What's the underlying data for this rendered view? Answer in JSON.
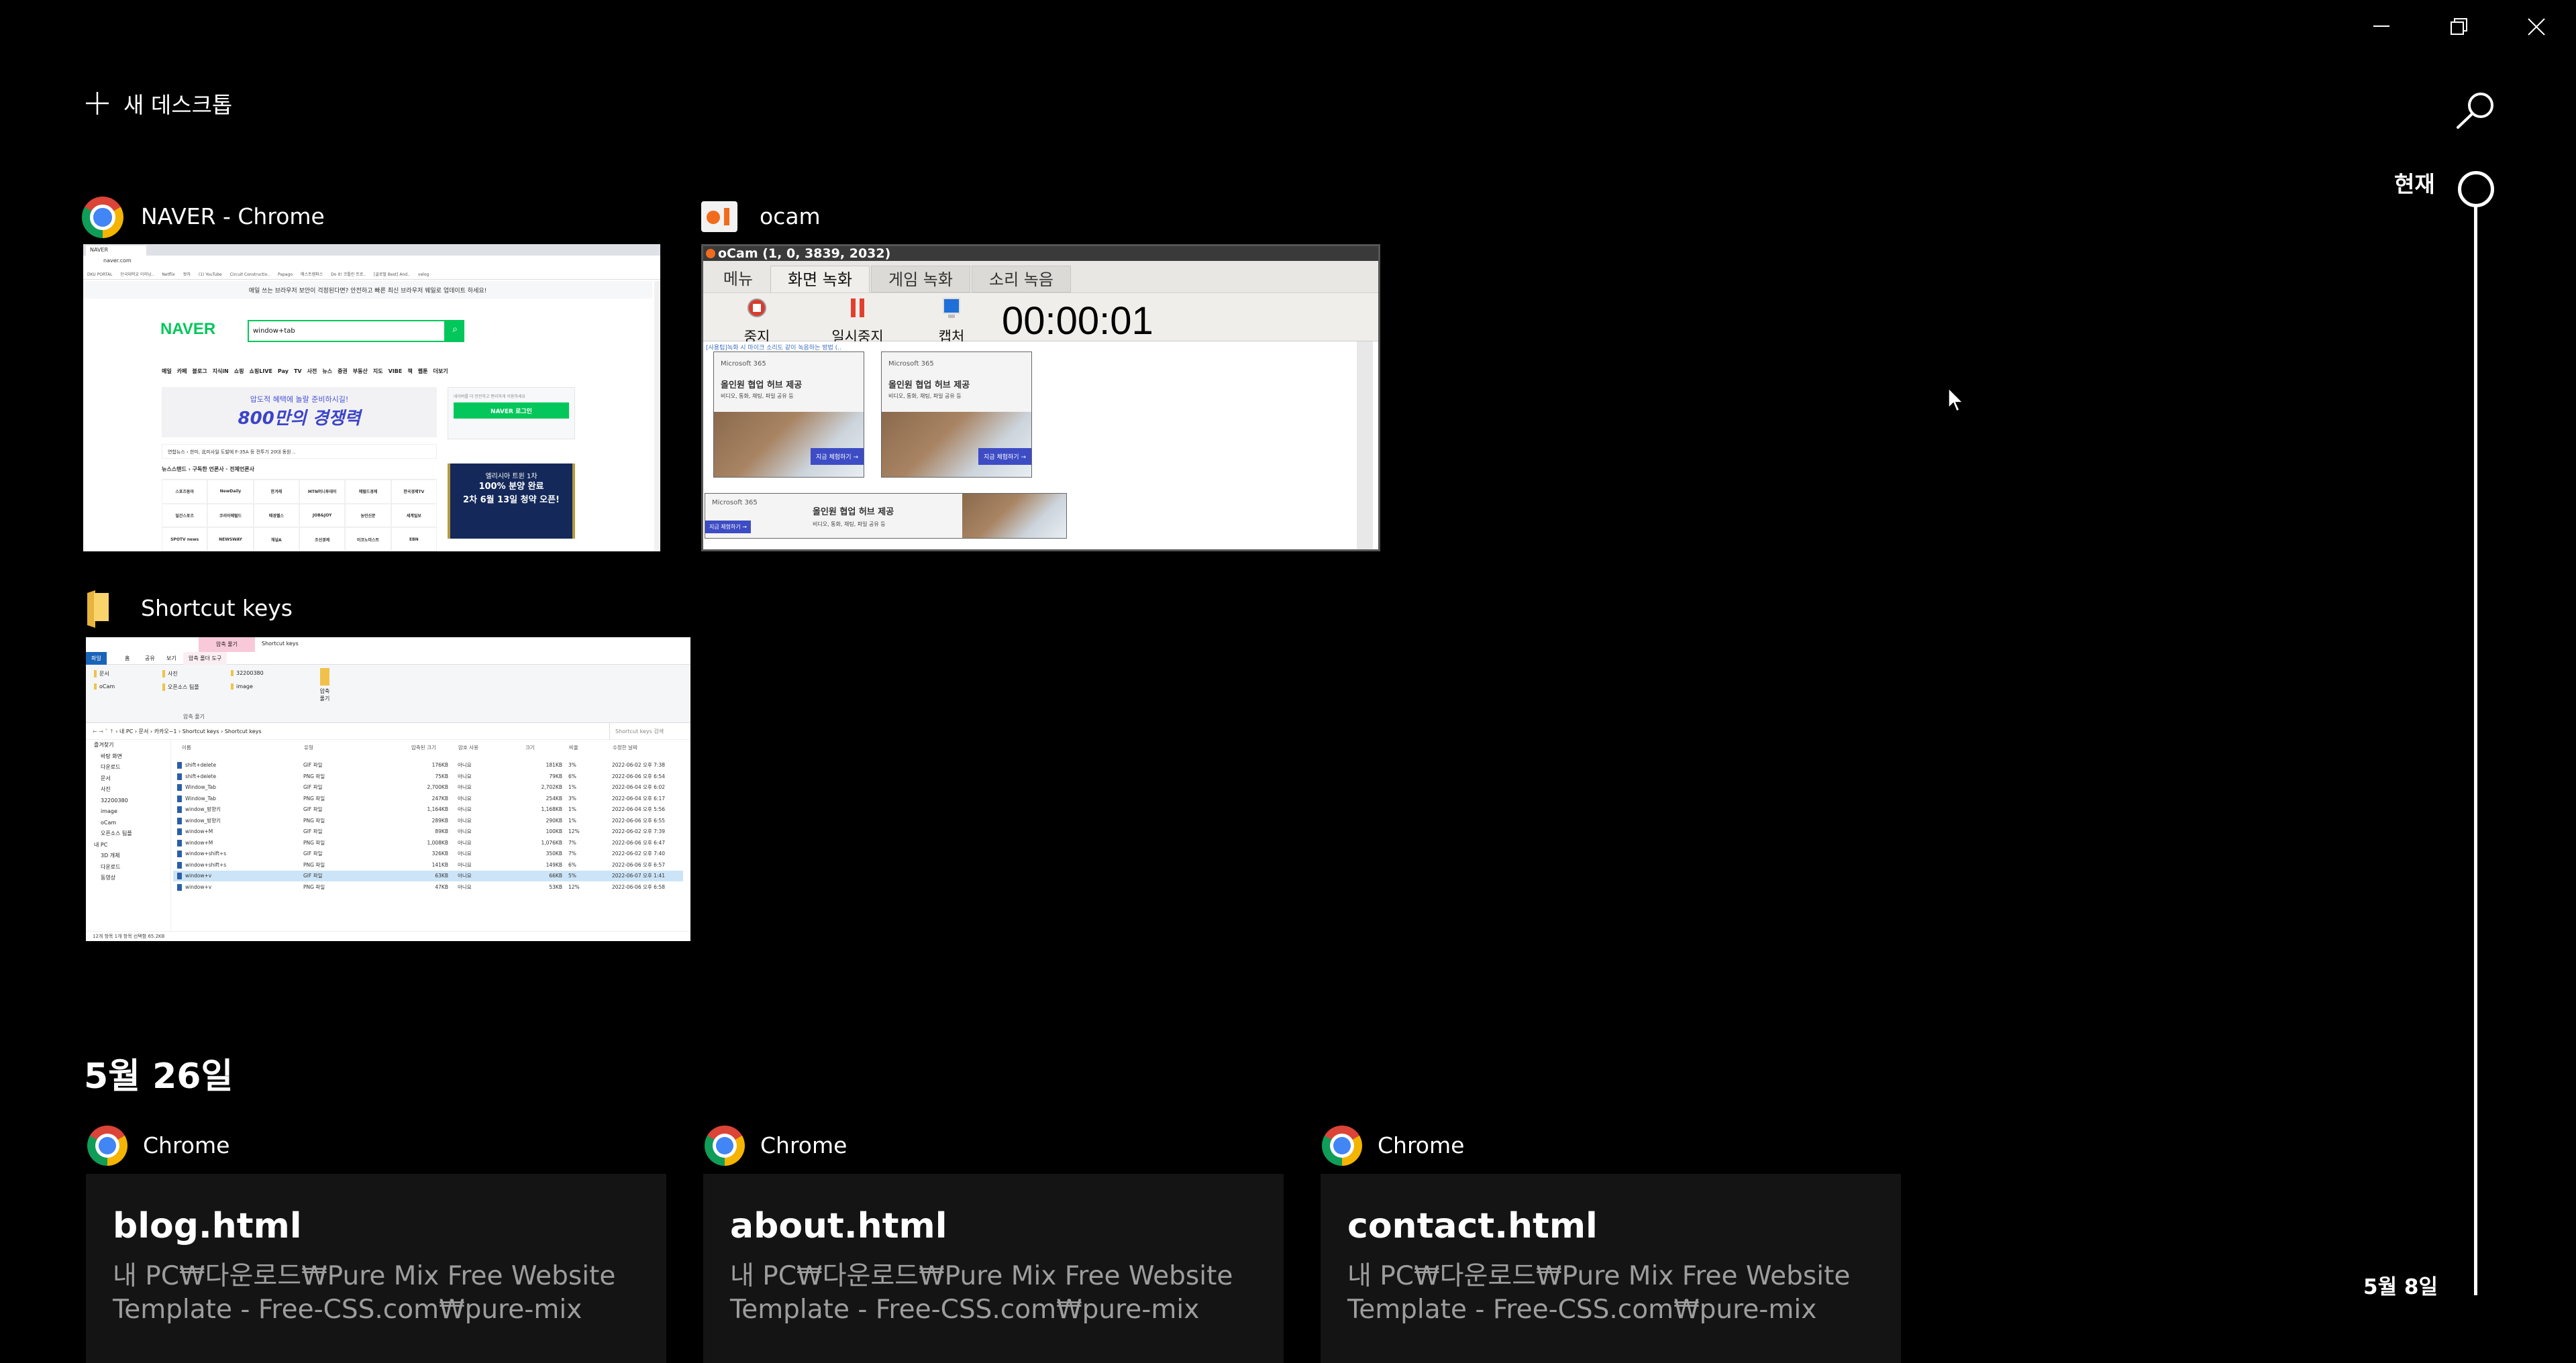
{
  "window_controls": {
    "minimize": "minimize",
    "restore": "restore",
    "close": "close"
  },
  "new_desktop": {
    "icon": "plus-icon",
    "label": "새 데스크톱"
  },
  "search": {
    "icon": "search-icon"
  },
  "timeline": {
    "current_label": "현재",
    "end_label": "5월 8일"
  },
  "open_windows": [
    {
      "title": "NAVER - Chrome",
      "icon": "chrome-icon"
    },
    {
      "title": "ocam",
      "icon": "ocam-icon"
    },
    {
      "title": "Shortcut keys",
      "icon": "folder-icon"
    }
  ],
  "naver": {
    "tab": "NAVER",
    "url": "naver.com",
    "bookmarks": [
      "DKU PORTAL",
      "단국대학교 이러닝..",
      "Netflix",
      "왓챠",
      "(1) YouTube",
      "Circuit Constructio..",
      "Papago",
      "메스트캠퍼스",
      "Do it! 코틀린 프로..",
      "[골로벌 Best] And..",
      "velog"
    ],
    "notice": "매일 쓰는 브라우저 보안이 걱정된다면? 안전하고 빠른 최신 브라우저 웨일로 업데이트 하세요!",
    "logo": "NAVER",
    "search_value": "window+tab",
    "menu": [
      "메일",
      "카페",
      "블로그",
      "지식iN",
      "쇼핑",
      "쇼핑LIVE",
      "Pay",
      "TV",
      "사전",
      "뉴스",
      "증권",
      "부동산",
      "지도",
      "VIBE",
      "책",
      "웹툰",
      "더보기"
    ],
    "banner_line1": "압도적 혜택에 놀랄 준비하시길!",
    "banner_line2": "800만의 경쟁력",
    "login_hint": "네이버를 더 안전하고 편리하게 이용하세요",
    "login_button": "NAVER 로그인",
    "news": "연합뉴스 › 한미, 北미사일 도발에 F-35A 등 전투기 20대 동원 ..",
    "newsstand": "뉴스스탠드 › 구독한 언론사 · 전체언론사",
    "press": [
      "스포츠동아",
      "NewDaily",
      "한겨레",
      "MTN머니투데이",
      "헤럴드경제",
      "한국경제TV",
      "일간스포츠",
      "코리아헤럴드",
      "매경헬스",
      "JOB&JOY",
      "농민신문",
      "세계일보",
      "SPOTV news",
      "NEWSWAY",
      "채널A",
      "조선경제",
      "이코노미스트",
      "EBN"
    ],
    "ad_line1": "엘리시아 트윈 1차",
    "ad_line2": "100% 분양 완료",
    "ad_line3": "2차 6월 13일 청약 오픈!"
  },
  "ocam": {
    "title": "oCam (1, 0, 3839, 2032)",
    "tabs": [
      "메뉴",
      "화면 녹화",
      "게임 녹화",
      "소리 녹음"
    ],
    "active_tab": "화면 녹화",
    "buttons": [
      {
        "label": "중지",
        "icon": "stop-icon"
      },
      {
        "label": "일시중지",
        "icon": "pause-icon"
      },
      {
        "label": "캡처",
        "icon": "monitor-icon"
      }
    ],
    "timer": "00:00:01",
    "tip_link": "[사용팁]녹화 시 마이크 소리도 같이 녹음하는 방법 (..",
    "ad_brand": "Microsoft 365",
    "ad_headline": "올인원 협업 허브 제공",
    "ad_sub": "비디오, 통화, 채팅, 파일 공유 등",
    "ad_cta": "지금 체험하기 →"
  },
  "explorer": {
    "context_tab": "압축 풀기",
    "window_title": "Shortcut keys",
    "tabs": [
      "파일",
      "홈",
      "공유",
      "보기",
      "압축 폴더 도구"
    ],
    "ribbon_items": [
      "문서",
      "사진",
      "32200380",
      "oCam",
      "오픈소스 팀플",
      "image"
    ],
    "ribbon_group": "압축 풀기",
    "extract_all": "압축 풀기",
    "breadcrumb": "› 내 PC › 문서 › 카카오~1 › Shortcut keys › Shortcut keys",
    "search_placeholder": "Shortcut keys 검색",
    "nav": [
      "즐겨찾기",
      "바탕 화면",
      "다운로드",
      "문서",
      "사진",
      "32200380",
      "image",
      "oCam",
      "오픈소스 팀플",
      "내 PC",
      "3D 개체",
      "다운로드",
      "동영상"
    ],
    "columns": [
      "이름",
      "유형",
      "압축된 크기",
      "암호 사용",
      "크기",
      "비율",
      "수정한 날짜"
    ],
    "files": [
      [
        "shift+delete",
        "GIF 파일",
        "176KB",
        "아니요",
        "181KB",
        "3%",
        "2022-06-02 오후 7:38"
      ],
      [
        "shift+delete",
        "PNG 파일",
        "75KB",
        "아니요",
        "79KB",
        "6%",
        "2022-06-06 오후 6:54"
      ],
      [
        "Window_Tab",
        "GIF 파일",
        "2,700KB",
        "아니요",
        "2,702KB",
        "1%",
        "2022-06-04 오후 6:02"
      ],
      [
        "Window_Tab",
        "PNG 파일",
        "247KB",
        "아니요",
        "254KB",
        "3%",
        "2022-06-04 오후 6:17"
      ],
      [
        "window_방향키",
        "GIF 파일",
        "1,164KB",
        "아니요",
        "1,168KB",
        "1%",
        "2022-06-04 오후 5:56"
      ],
      [
        "window_방향키",
        "PNG 파일",
        "289KB",
        "아니요",
        "290KB",
        "1%",
        "2022-06-06 오후 6:55"
      ],
      [
        "window+M",
        "GIF 파일",
        "89KB",
        "아니요",
        "100KB",
        "12%",
        "2022-06-02 오후 7:39"
      ],
      [
        "window+M",
        "PNG 파일",
        "1,008KB",
        "아니요",
        "1,076KB",
        "7%",
        "2022-06-06 오후 6:47"
      ],
      [
        "window+shift+s",
        "GIF 파일",
        "326KB",
        "아니요",
        "350KB",
        "7%",
        "2022-06-02 오후 7:40"
      ],
      [
        "window+shift+s",
        "PNG 파일",
        "141KB",
        "아니요",
        "149KB",
        "6%",
        "2022-06-06 오후 6:57"
      ],
      [
        "window+v",
        "GIF 파일",
        "63KB",
        "아니요",
        "66KB",
        "5%",
        "2022-06-07 오후 1:41"
      ],
      [
        "window+v",
        "PNG 파일",
        "47KB",
        "아니요",
        "53KB",
        "12%",
        "2022-06-06 오후 6:58"
      ]
    ],
    "selected_index": 10,
    "status": "12개 항목    1개 항목 선택함 65.2KB"
  },
  "history": {
    "date_heading": "5월 26일",
    "cards": [
      {
        "app": "Chrome",
        "title": "blog.html",
        "path": "내 PC₩다운로드₩Pure Mix Free Website Template - Free-CSS.com₩pure-mix"
      },
      {
        "app": "Chrome",
        "title": "about.html",
        "path": "내 PC₩다운로드₩Pure Mix Free Website Template - Free-CSS.com₩pure-mix"
      },
      {
        "app": "Chrome",
        "title": "contact.html",
        "path": "내 PC₩다운로드₩Pure Mix Free Website Template - Free-CSS.com₩pure-mix"
      }
    ]
  }
}
